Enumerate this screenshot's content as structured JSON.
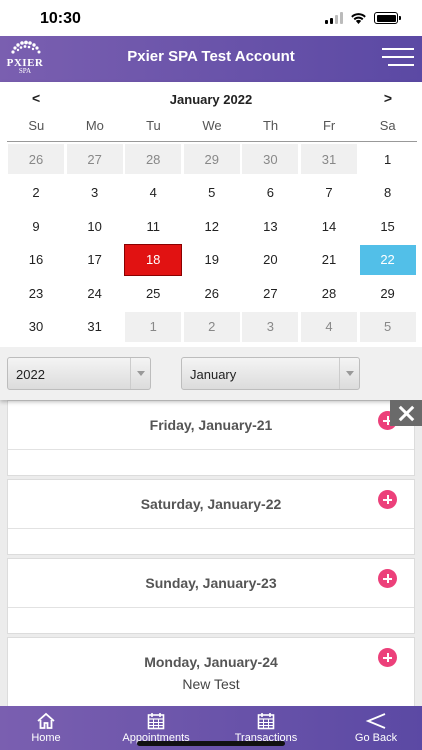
{
  "status_bar": {
    "time": "10:30"
  },
  "header": {
    "logo_line1": "PXIER",
    "logo_line2": "SPA",
    "title": "Pxier SPA Test Account"
  },
  "calendar": {
    "prev": "<",
    "next": ">",
    "month_title": "January 2022",
    "weekdays": [
      "Su",
      "Mo",
      "Tu",
      "We",
      "Th",
      "Fr",
      "Sa"
    ],
    "days": [
      {
        "d": "26",
        "other": true
      },
      {
        "d": "27",
        "other": true
      },
      {
        "d": "28",
        "other": true
      },
      {
        "d": "29",
        "other": true
      },
      {
        "d": "30",
        "other": true
      },
      {
        "d": "31",
        "other": true
      },
      {
        "d": "1"
      },
      {
        "d": "2"
      },
      {
        "d": "3"
      },
      {
        "d": "4"
      },
      {
        "d": "5"
      },
      {
        "d": "6"
      },
      {
        "d": "7"
      },
      {
        "d": "8"
      },
      {
        "d": "9"
      },
      {
        "d": "10"
      },
      {
        "d": "11"
      },
      {
        "d": "12"
      },
      {
        "d": "13"
      },
      {
        "d": "14"
      },
      {
        "d": "15"
      },
      {
        "d": "16"
      },
      {
        "d": "17"
      },
      {
        "d": "18",
        "today": true
      },
      {
        "d": "19"
      },
      {
        "d": "20"
      },
      {
        "d": "21"
      },
      {
        "d": "22",
        "selected": true
      },
      {
        "d": "23"
      },
      {
        "d": "24"
      },
      {
        "d": "25"
      },
      {
        "d": "26"
      },
      {
        "d": "27"
      },
      {
        "d": "28"
      },
      {
        "d": "29"
      },
      {
        "d": "30"
      },
      {
        "d": "31"
      },
      {
        "d": "1",
        "other": true
      },
      {
        "d": "2",
        "other": true
      },
      {
        "d": "3",
        "other": true
      },
      {
        "d": "4",
        "other": true
      },
      {
        "d": "5",
        "other": true
      }
    ],
    "year_select": "2022",
    "month_select": "January",
    "today_color": "#e11212",
    "selected_color": "#52bfe8"
  },
  "schedule": [
    {
      "date_label": "Friday, January-21",
      "appointment": ""
    },
    {
      "date_label": "Saturday, January-22",
      "appointment": ""
    },
    {
      "date_label": "Sunday, January-23",
      "appointment": ""
    },
    {
      "date_label": "Monday, January-24",
      "appointment": "New Test"
    }
  ],
  "bottom_nav": {
    "home": "Home",
    "appointments": "Appointments",
    "transactions": "Transactions",
    "go_back": "Go Back"
  },
  "theme": {
    "header_start": "#7a5fb0",
    "header_end": "#5b49a4",
    "add_button": "#ec407a"
  }
}
